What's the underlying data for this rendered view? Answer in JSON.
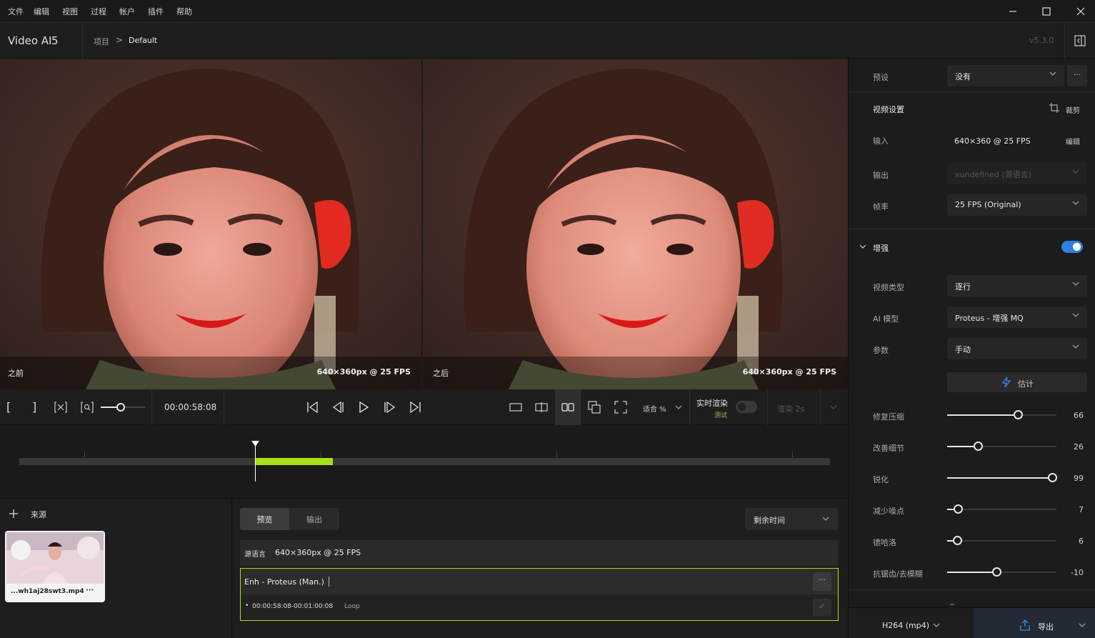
{
  "menu": [
    "文件",
    "编辑",
    "视图",
    "过程",
    "帐户",
    "插件",
    "帮助"
  ],
  "app": {
    "name": "Video AI",
    "version_num": "5",
    "version": "v5.3.0"
  },
  "breadcrumb": {
    "project": "项目",
    "separator": ">",
    "current": "Default"
  },
  "preview": {
    "before_label": "之前",
    "after_label": "之后",
    "before_res": "640×360px @ 25 FPS",
    "after_res": "640×360px @ 25 FPS"
  },
  "controls": {
    "in_mark": "[",
    "out_mark": "]",
    "timecode": "00:00:58:08",
    "fit": "适合 %",
    "realtime_label": "实时渲染",
    "realtime_sub": "测试",
    "render_label": "渲染 2s",
    "zoom_level": 0.45
  },
  "timeline": {
    "playhead_fraction": 0.291,
    "segment_start_fraction": 0.291,
    "segment_end_fraction": 0.387,
    "accent": "#a6e01a"
  },
  "sources": {
    "add_label": "来源",
    "file_name": "...wh1aj28swt3.mp4",
    "more": "···"
  },
  "queue": {
    "tabs": [
      "预览",
      "输出"
    ],
    "sort": "剩余时间",
    "source_label": "源语言",
    "source_res": "640×360px @ 25 FPS",
    "item_title": "Enh - Proteus (Man.)",
    "item_range": "00:00:58:08-00:01:00:08",
    "item_loop": "Loop",
    "more": "···",
    "check": "✓"
  },
  "right": {
    "preset_label": "预设",
    "preset_value": "没有",
    "preset_more": "···",
    "video_settings": "视频设置",
    "crop": "裁剪",
    "input_label": "输入",
    "input_value": "640×360 @ 25 FPS",
    "input_edit": "编辑",
    "output_label": "输出",
    "output_value": "xundefined (源语言)",
    "fps_label": "帧率",
    "fps_value": "25 FPS (Original)",
    "enhance": "增强",
    "enhance_on": true,
    "video_type_label": "视频类型",
    "video_type_value": "逐行",
    "ai_model_label": "AI 模型",
    "ai_model_value": "Proteus - 增强 MQ",
    "params_label": "参数",
    "params_value": "手动",
    "estimate": "估计",
    "sliders": [
      {
        "label": "修复压缩",
        "value": "66",
        "fraction": 0.65
      },
      {
        "label": "改善细节",
        "value": "26",
        "fraction": 0.28
      },
      {
        "label": "锐化",
        "value": "99",
        "fraction": 0.96
      },
      {
        "label": "减少噪点",
        "value": "7",
        "fraction": 0.1
      },
      {
        "label": "德哈洛",
        "value": "6",
        "fraction": 0.09
      },
      {
        "label": "抗锯齿/去模糊",
        "value": "-10",
        "fraction": 0.45
      }
    ],
    "codec": "H264 (mp4)",
    "export": "导出"
  }
}
